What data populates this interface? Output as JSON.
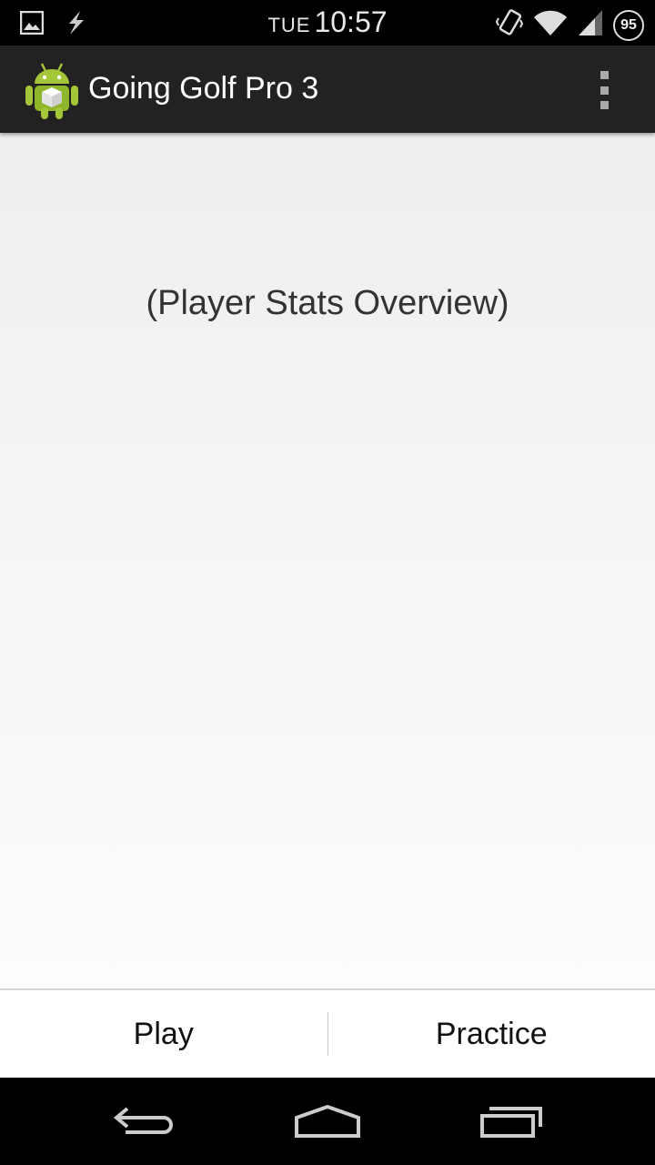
{
  "status_bar": {
    "day": "TUE",
    "time": "10:57",
    "battery_level": "95",
    "icons": [
      "gallery-notification-icon",
      "usb-debug-icon",
      "vibrate-icon",
      "wifi-icon",
      "cell-signal-icon",
      "battery-icon"
    ]
  },
  "action_bar": {
    "title": "Going Golf Pro 3",
    "app_icon": "android-app-icon",
    "overflow_icon": "overflow-menu-icon"
  },
  "main": {
    "placeholder_text": "(Player Stats Overview)"
  },
  "tabs": [
    {
      "label": "Play"
    },
    {
      "label": "Practice"
    }
  ],
  "nav_bar": {
    "icons": [
      "back-icon",
      "home-icon",
      "recents-icon"
    ]
  },
  "colors": {
    "action_bar_bg": "#222222",
    "android_green": "#a4c639",
    "status_bar_bg": "#000000"
  }
}
